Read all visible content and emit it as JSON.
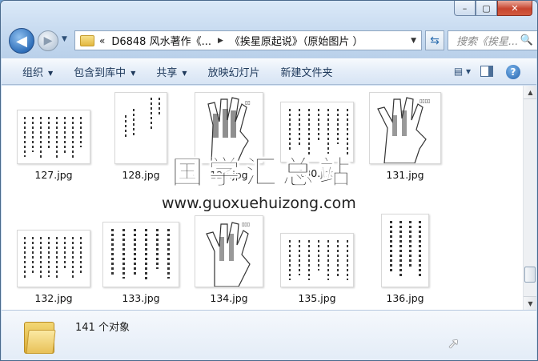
{
  "window": {
    "caption_buttons": {
      "minimize": "–",
      "maximize": "▢",
      "close": "✕"
    }
  },
  "nav": {
    "back_icon": "back-arrow-icon",
    "forward_icon": "forward-arrow-icon",
    "address": {
      "chevron": "«",
      "segments": [
        "D6848 风水著作《...",
        "《挨星原起说》（原始图片 ）"
      ],
      "separator": "▶"
    },
    "search_placeholder": "搜索《挨星...",
    "search_icon": "🔍"
  },
  "toolbar": {
    "items": [
      {
        "label": "组织",
        "has_menu": true
      },
      {
        "label": "包含到库中",
        "has_menu": true
      },
      {
        "label": "共享",
        "has_menu": true
      },
      {
        "label": "放映幻灯片",
        "has_menu": false
      },
      {
        "label": "新建文件夹",
        "has_menu": false
      }
    ],
    "help_label": "?"
  },
  "files": [
    {
      "name": "127.jpg",
      "kind": "text"
    },
    {
      "name": "128.jpg",
      "kind": "text-sparse"
    },
    {
      "name": "129.jpg",
      "kind": "hand"
    },
    {
      "name": "130.jpg",
      "kind": "text"
    },
    {
      "name": "131.jpg",
      "kind": "hand"
    },
    {
      "name": "132.jpg",
      "kind": "text"
    },
    {
      "name": "133.jpg",
      "kind": "text-bold"
    },
    {
      "name": "134.jpg",
      "kind": "hand"
    },
    {
      "name": "135.jpg",
      "kind": "text"
    },
    {
      "name": "136.jpg",
      "kind": "text-bold"
    }
  ],
  "watermark": {
    "title": "国学汇总站",
    "url": "www.guoxuehuizong.com"
  },
  "details": {
    "count_text": "141 个对象"
  }
}
